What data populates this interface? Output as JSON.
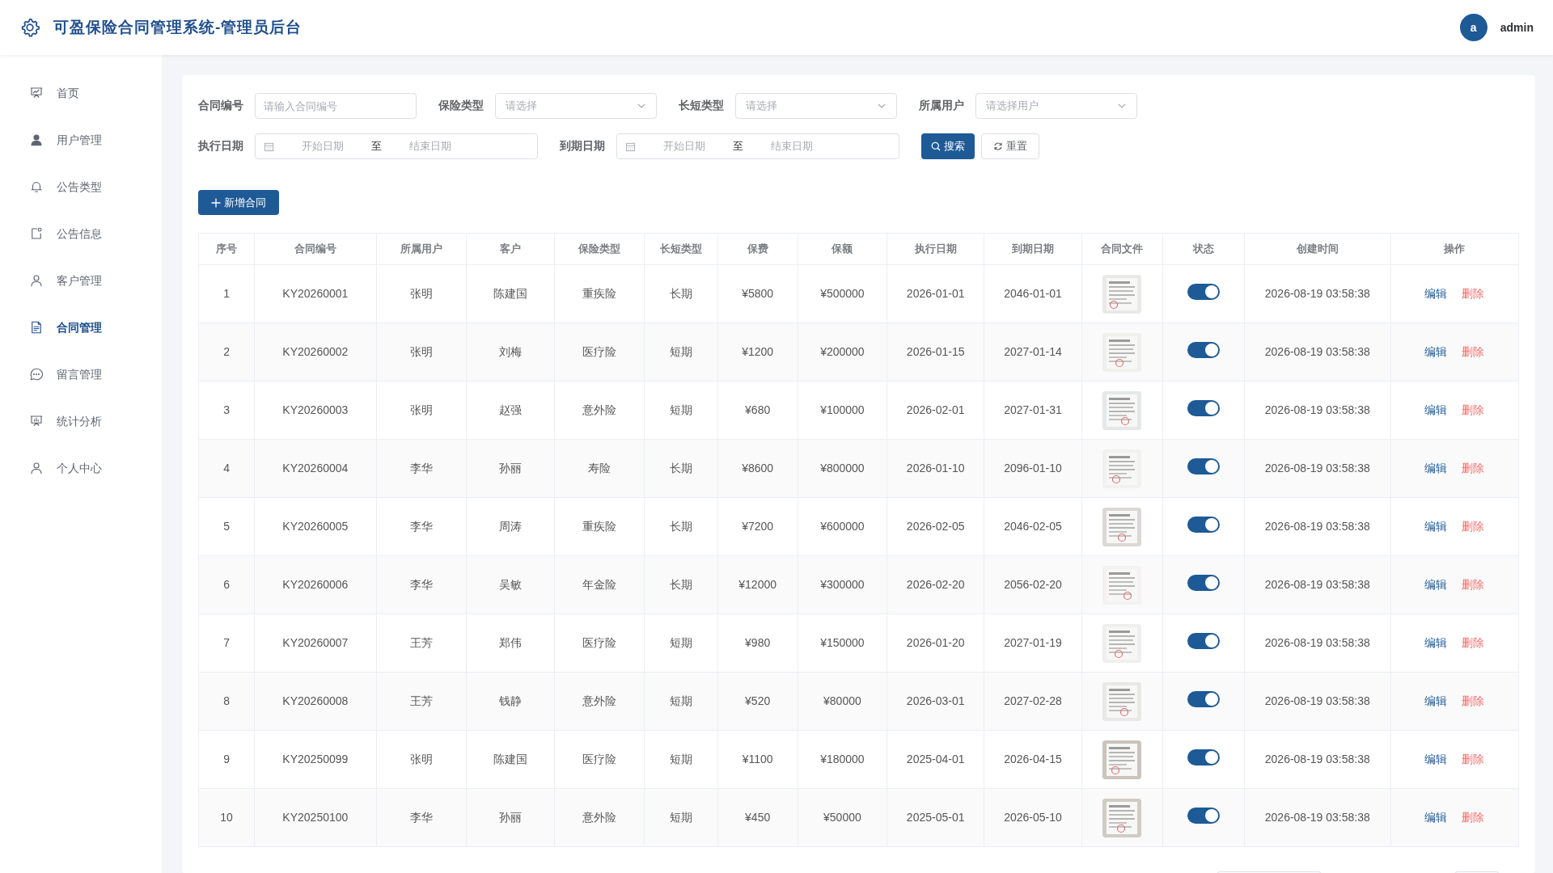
{
  "header": {
    "title": "可盈保险合同管理系统-管理员后台",
    "user": {
      "avatar_letter": "a",
      "name": "admin"
    }
  },
  "sidebar": {
    "items": [
      {
        "label": "首页",
        "selected": false
      },
      {
        "label": "用户管理",
        "selected": false
      },
      {
        "label": "公告类型",
        "selected": false
      },
      {
        "label": "公告信息",
        "selected": false
      },
      {
        "label": "客户管理",
        "selected": false
      },
      {
        "label": "合同管理",
        "selected": true
      },
      {
        "label": "留言管理",
        "selected": false
      },
      {
        "label": "统计分析",
        "selected": false
      },
      {
        "label": "个人中心",
        "selected": false
      }
    ]
  },
  "filters": [
    {
      "kind": "text",
      "label": "合同编号",
      "placeholder": "请输入合同编号"
    },
    {
      "kind": "select",
      "label": "保险类型",
      "placeholder": "请选择"
    },
    {
      "kind": "select",
      "label": "长短类型",
      "placeholder": "请选择"
    },
    {
      "kind": "select",
      "label": "所属用户",
      "placeholder": "请选择用户"
    }
  ],
  "date_filters": [
    {
      "label": "执行日期",
      "start_placeholder": "开始日期",
      "separator": "至",
      "end_placeholder": "结束日期"
    },
    {
      "label": "到期日期",
      "start_placeholder": "开始日期",
      "separator": "至",
      "end_placeholder": "结束日期"
    }
  ],
  "search_button": "搜索",
  "reset_button": "重置",
  "add_button": "新增合同",
  "table": {
    "columns": [
      "序号",
      "合同编号",
      "所属用户",
      "客户",
      "保险类型",
      "长短类型",
      "保费",
      "保额",
      "执行日期",
      "到期日期",
      "合同文件",
      "状态",
      "创建时间",
      "操作"
    ],
    "rows": [
      {
        "cells": [
          "1",
          "KY20260001",
          "张明",
          "陈建国",
          "重疾险",
          "长期",
          "¥5800",
          "¥500000",
          "2026-01-01",
          "2046-01-01"
        ],
        "on": true,
        "created": "2026-08-19 03:58:38",
        "actions": [
          "编辑",
          "删除"
        ]
      },
      {
        "cells": [
          "2",
          "KY20260002",
          "张明",
          "刘梅",
          "医疗险",
          "短期",
          "¥1200",
          "¥200000",
          "2026-01-15",
          "2027-01-14"
        ],
        "on": true,
        "created": "2026-08-19 03:58:38",
        "actions": [
          "编辑",
          "删除"
        ]
      },
      {
        "cells": [
          "3",
          "KY20260003",
          "张明",
          "赵强",
          "意外险",
          "短期",
          "¥680",
          "¥100000",
          "2026-02-01",
          "2027-01-31"
        ],
        "on": true,
        "created": "2026-08-19 03:58:38",
        "actions": [
          "编辑",
          "删除"
        ]
      },
      {
        "cells": [
          "4",
          "KY20260004",
          "李华",
          "孙丽",
          "寿险",
          "长期",
          "¥8600",
          "¥800000",
          "2026-01-10",
          "2096-01-10"
        ],
        "on": true,
        "created": "2026-08-19 03:58:38",
        "actions": [
          "编辑",
          "删除"
        ]
      },
      {
        "cells": [
          "5",
          "KY20260005",
          "李华",
          "周涛",
          "重疾险",
          "长期",
          "¥7200",
          "¥600000",
          "2026-02-05",
          "2046-02-05"
        ],
        "on": true,
        "created": "2026-08-19 03:58:38",
        "actions": [
          "编辑",
          "删除"
        ]
      },
      {
        "cells": [
          "6",
          "KY20260006",
          "李华",
          "吴敏",
          "年金险",
          "长期",
          "¥12000",
          "¥300000",
          "2026-02-20",
          "2056-02-20"
        ],
        "on": true,
        "created": "2026-08-19 03:58:38",
        "actions": [
          "编辑",
          "删除"
        ]
      },
      {
        "cells": [
          "7",
          "KY20260007",
          "王芳",
          "郑伟",
          "医疗险",
          "短期",
          "¥980",
          "¥150000",
          "2026-01-20",
          "2027-01-19"
        ],
        "on": true,
        "created": "2026-08-19 03:58:38",
        "actions": [
          "编辑",
          "删除"
        ]
      },
      {
        "cells": [
          "8",
          "KY20260008",
          "王芳",
          "钱静",
          "意外险",
          "短期",
          "¥520",
          "¥80000",
          "2026-03-01",
          "2027-02-28"
        ],
        "on": true,
        "created": "2026-08-19 03:58:38",
        "actions": [
          "编辑",
          "删除"
        ]
      },
      {
        "cells": [
          "9",
          "KY20250099",
          "张明",
          "陈建国",
          "医疗险",
          "短期",
          "¥1100",
          "¥180000",
          "2025-04-01",
          "2026-04-15"
        ],
        "on": true,
        "created": "2026-08-19 03:58:38",
        "actions": [
          "编辑",
          "删除"
        ]
      },
      {
        "cells": [
          "10",
          "KY20250100",
          "李华",
          "孙丽",
          "意外险",
          "短期",
          "¥450",
          "¥50000",
          "2025-05-01",
          "2026-05-10"
        ],
        "on": true,
        "created": "2026-08-19 03:58:38",
        "actions": [
          "编辑",
          "删除"
        ]
      }
    ]
  },
  "pagination": {
    "kind": "cut_off"
  }
}
